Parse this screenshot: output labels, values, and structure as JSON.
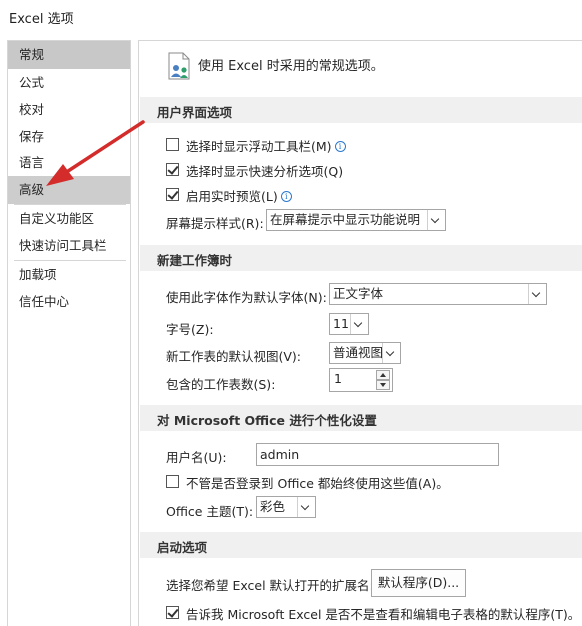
{
  "window": {
    "title": "Excel 选项"
  },
  "sidebar": {
    "items": [
      {
        "label": "常规",
        "state": "selected"
      },
      {
        "label": "公式"
      },
      {
        "label": "校对"
      },
      {
        "label": "保存"
      },
      {
        "label": "语言"
      },
      {
        "label": "高级",
        "state": "highlighted"
      },
      {
        "label": "自定义功能区"
      },
      {
        "label": "快速访问工具栏"
      },
      {
        "label": "加载项"
      },
      {
        "label": "信任中心"
      }
    ]
  },
  "header": {
    "text": "使用 Excel 时采用的常规选项。",
    "icon": "general-options-icon"
  },
  "ui_section": {
    "title": "用户界面选项",
    "opt_mini_toolbar": {
      "label": "选择时显示浮动工具栏(M)",
      "checked": false
    },
    "opt_quick_analysis": {
      "label": "选择时显示快速分析选项(Q)",
      "checked": true
    },
    "opt_live_preview": {
      "label": "启用实时预览(L)",
      "checked": true
    },
    "screentip_label": "屏幕提示样式(R):",
    "screentip_value": "在屏幕提示中显示功能说明"
  },
  "workbook_section": {
    "title": "新建工作簿时",
    "font_label": "使用此字体作为默认字体(N):",
    "font_value": "正文字体",
    "size_label": "字号(Z):",
    "size_value": "11",
    "view_label": "新工作表的默认视图(V):",
    "view_value": "普通视图",
    "sheets_label": "包含的工作表数(S):",
    "sheets_value": "1"
  },
  "personalize_section": {
    "title": "对 Microsoft Office 进行个性化设置",
    "username_label": "用户名(U):",
    "username_value": "admin",
    "always_use": {
      "label": "不管是否登录到 Office 都始终使用这些值(A)。",
      "checked": false
    },
    "theme_label": "Office 主题(T):",
    "theme_value": "彩色"
  },
  "startup_section": {
    "title": "启动选项",
    "ext_label": "选择您希望 Excel 默认打开的扩展名:",
    "default_programs_button": "默认程序(D)...",
    "tell_me": {
      "label": "告诉我 Microsoft Excel 是否不是查看和编辑电子表格的默认程序(T)。",
      "checked": true
    }
  },
  "annotation": {
    "color": "#d42b2b"
  }
}
